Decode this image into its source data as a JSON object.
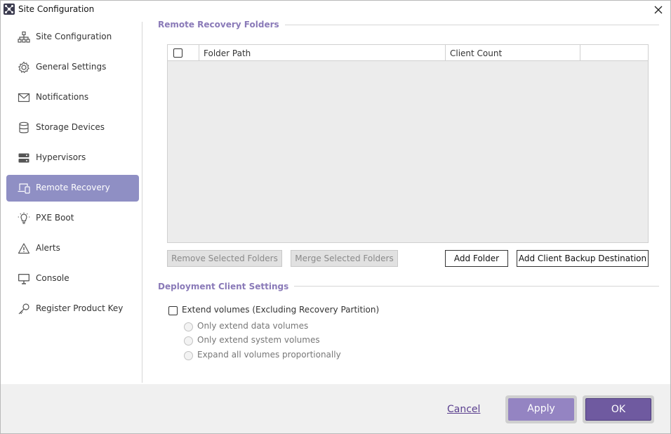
{
  "window": {
    "title": "Site Configuration"
  },
  "sidebar": {
    "items": [
      {
        "label": "Site Configuration",
        "icon": "sitemap-icon"
      },
      {
        "label": "General Settings",
        "icon": "gear-icon"
      },
      {
        "label": "Notifications",
        "icon": "envelope-icon"
      },
      {
        "label": "Storage Devices",
        "icon": "database-icon"
      },
      {
        "label": "Hypervisors",
        "icon": "server-icon"
      },
      {
        "label": "Remote Recovery",
        "icon": "devices-icon",
        "active": true
      },
      {
        "label": "PXE Boot",
        "icon": "lightbulb-icon"
      },
      {
        "label": "Alerts",
        "icon": "warning-icon"
      },
      {
        "label": "Console",
        "icon": "monitor-icon"
      },
      {
        "label": "Register Product Key",
        "icon": "key-icon"
      }
    ]
  },
  "remote_recovery": {
    "section_title": "Remote Recovery Folders",
    "columns": [
      "Folder Path",
      "Client Count"
    ],
    "rows": [],
    "buttons": {
      "remove": "Remove Selected Folders",
      "merge": "Merge Selected Folders",
      "add_folder": "Add Folder",
      "add_destination": "Add Client Backup Destination"
    }
  },
  "deployment": {
    "section_title": "Deployment Client Settings",
    "extend_label": "Extend volumes (Excluding Recovery Partition)",
    "options": [
      "Only extend data volumes",
      "Only extend system volumes",
      "Expand all volumes proportionally"
    ]
  },
  "footer": {
    "cancel": "Cancel",
    "apply": "Apply",
    "ok": "OK"
  },
  "colors": {
    "accent": "#8f8fc4",
    "section_title": "#8a7ab8",
    "ok_button": "#6f5aa0",
    "apply_button": "#9484c2"
  }
}
